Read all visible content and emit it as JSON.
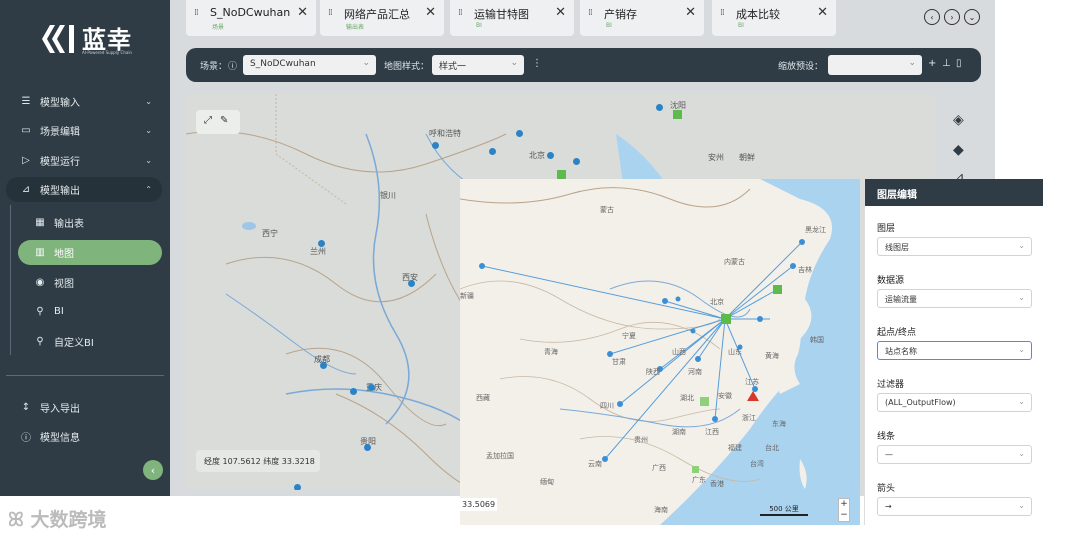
{
  "brand": {
    "name": "蓝幸",
    "tagline": "AI-Powered Supply Chain"
  },
  "sidebar": {
    "items": [
      {
        "label": "模型输入",
        "icon": "list-icon",
        "chevron": "⌄"
      },
      {
        "label": "场景编辑",
        "icon": "monitor-icon",
        "chevron": "⌄"
      },
      {
        "label": "模型运行",
        "icon": "play-icon",
        "chevron": "⌄"
      },
      {
        "label": "模型输出",
        "icon": "chart-icon",
        "chevron": "⌃"
      }
    ],
    "subitems": [
      {
        "label": "输出表",
        "icon": "table-icon"
      },
      {
        "label": "地图",
        "icon": "map-icon"
      },
      {
        "label": "视图",
        "icon": "eye-icon"
      },
      {
        "label": "BI",
        "icon": "bi-icon"
      },
      {
        "label": "自定义BI",
        "icon": "custom-bi-icon"
      }
    ],
    "footer": [
      {
        "label": "导入导出",
        "icon": "import-export-icon"
      },
      {
        "label": "模型信息",
        "icon": "info-icon"
      }
    ],
    "collapse": "‹"
  },
  "tabs": [
    {
      "name": "S_NoDCwuhan",
      "sub": "场景"
    },
    {
      "name": "网络产品汇总",
      "sub": "输出表"
    },
    {
      "name": "运输甘特图",
      "sub": "BI"
    },
    {
      "name": "产销存",
      "sub": "BI"
    },
    {
      "name": "成本比较",
      "sub": "BI"
    }
  ],
  "toolbar": {
    "scene_label": "场景：",
    "scene_value": "S_NoDCwuhan",
    "style_label": "地图样式：",
    "style_value": "样式一",
    "zoom_label": "缩放预设：",
    "zoom_value": ""
  },
  "map_back": {
    "labels": [
      "呼和浩特",
      "北京",
      "银川",
      "西宁",
      "兰州",
      "西安",
      "成都",
      "重庆",
      "贵阳",
      "安州",
      "朝鲜",
      "沈阳"
    ],
    "coord_text": "经度 107.5612  纬度 33.3218"
  },
  "overlay_map": {
    "labels": [
      "蒙古",
      "内蒙古",
      "黑龙江",
      "吉林",
      "北京",
      "宁夏",
      "甘肃",
      "青海",
      "山西",
      "陕西",
      "河南",
      "山东",
      "江苏",
      "四川",
      "湖北",
      "安徽",
      "浙江",
      "西藏",
      "湖南",
      "江西",
      "福建",
      "贵州",
      "云南",
      "广西",
      "广东",
      "台湾",
      "东海",
      "黄海",
      "韩国",
      "孟加拉国",
      "缅甸",
      "海南",
      "香港",
      "台北",
      "新疆"
    ],
    "coord_text": "33.5069",
    "scale_text": "500 公里",
    "zoom_in": "+",
    "zoom_out": "−"
  },
  "layer_panel": {
    "title": "图层编辑",
    "fields": [
      {
        "label": "图层",
        "value": "线图层"
      },
      {
        "label": "数据源",
        "value": "运输流量"
      },
      {
        "label": "起点/终点",
        "value": "站点名称"
      },
      {
        "label": "过滤器",
        "value": "(ALL_OutputFlow)"
      },
      {
        "label": "线条",
        "value": "—"
      },
      {
        "label": "箭头",
        "value": "→"
      }
    ]
  },
  "watermark": "大数跨境",
  "colors": {
    "sidebar": "#2f3c45",
    "accent": "#7fb47d",
    "flow": "#3b8fd6",
    "water": "#aad3f0"
  }
}
